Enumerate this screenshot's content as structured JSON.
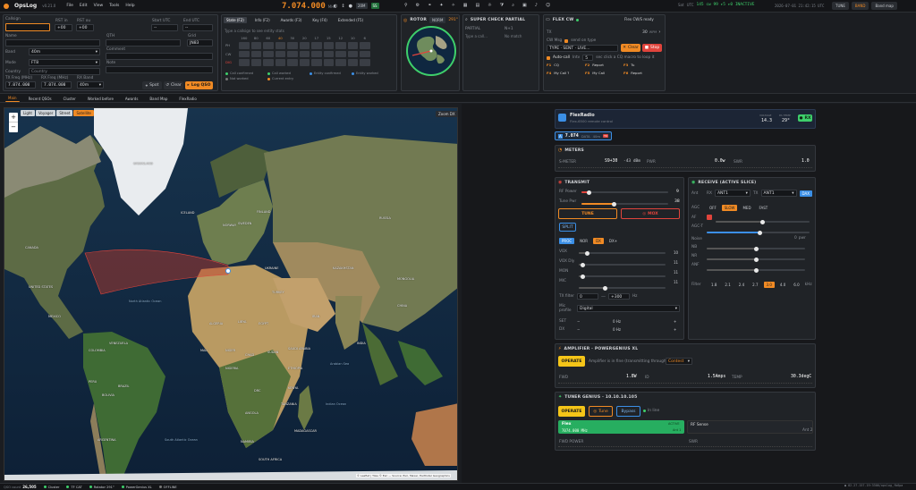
{
  "app": {
    "name": "OpsLog",
    "version": "v0.21.0",
    "menu": [
      "File",
      "Edit",
      "View",
      "Tools",
      "Help"
    ]
  },
  "topbar": {
    "frequency": "7.074.000",
    "freq_unit": "MHz",
    "mode_badge": "20M",
    "band_badge": "SS",
    "clock_label": "Sat",
    "clock_time": "2026-07-01 21:42:15 UTC",
    "utc_label": "UTC",
    "status": "145  cw 99  ▸5  ▸0  INACTIVE",
    "btn_tune": "TUNE",
    "btn_band": "BAND",
    "btn_bandmap": "Band map"
  },
  "entry": {
    "callsign_label": "Callsign",
    "rst_in_label": "RST in",
    "rst_in": "+00",
    "rst_out_label": "RST ou",
    "rst_out": "+00",
    "start_label": "Start UTC",
    "start_val": "--",
    "end_label": "End UTC",
    "end_val": "--",
    "name_label": "Name",
    "qth_label": "QTH",
    "grid_label": "Grid",
    "grid_val": "JN83",
    "band_label": "Band",
    "band_val": "40m",
    "comment_label": "Comment",
    "mode_label": "Mode",
    "mode_val": "FT8",
    "note_label": "Note",
    "country_label": "Country",
    "country_ph": "Country",
    "txfreq_label": "TX Freq (MHz)",
    "txfreq": "7.074.000",
    "rxfreq_label": "RX Freq (MHz)",
    "rxfreq": "7.074.000",
    "rxband_label": "RX Band",
    "rxband": "40m",
    "spot_btn": "Spot",
    "clear_btn": "Clear",
    "log_btn": "Log QSO"
  },
  "band_tabs": [
    "State (F2)",
    "Info (F2)",
    "Awards (F3)",
    "Key (F4)",
    "Extended (F5)"
  ],
  "band_grid": {
    "hint": "Type a callsign to see entity stats",
    "bands": [
      "160",
      "80",
      "60",
      "40",
      "30",
      "20",
      "17",
      "15",
      "12",
      "10",
      "6"
    ],
    "rows": [
      "PH",
      "CW",
      "DIG"
    ],
    "legend": [
      "Call confirmed",
      "Call worked",
      "Entity confirmed",
      "Entity worked",
      "Not worked",
      "Current entry"
    ]
  },
  "rotor": {
    "title": "ROTOR",
    "mode": "NORM",
    "az": "291°"
  },
  "scp": {
    "title": "SUPER CHECK PARTIAL",
    "col1": "PARTIAL",
    "col2": "N+1",
    "ph1": "Type a call...",
    "ph2": "No match"
  },
  "flex_cw": {
    "title": "FLEX CW",
    "status": "Flex CW/S ready",
    "tx_label": "TX",
    "wpm": "30",
    "wpm_unit": "WPM",
    "cw_label": "CW Msg",
    "cw_opt": "send on type",
    "type_ph": "TYPE · SENT · LIVE...",
    "clear_btn": "Clear",
    "stop_btn": "Stop",
    "autocall_label": "Auto-call",
    "interval_label": "Intv",
    "interval": "5",
    "interval_hint": "sec   click a CQ macro to loop it",
    "macros": [
      [
        "F1",
        "CQ"
      ],
      [
        "F2",
        "Report"
      ],
      [
        "F3",
        "Tu"
      ],
      [
        "F4",
        "My Call ?"
      ],
      [
        "F5",
        "My Call"
      ],
      [
        "F6",
        "Report"
      ]
    ]
  },
  "tabs": [
    "Main",
    "Recent QSOs",
    "Cluster",
    "Worked before",
    "Awards",
    "Band Map",
    "FlexRadio"
  ],
  "map": {
    "layers": [
      "Light",
      "Voyager",
      "Street",
      "Satellite"
    ],
    "active_layer": "Satellite",
    "zoom_btn": "Zoom DX",
    "attribution": "© Leaflet | Tiles © Esri — Source: Esri, Maxar, Earthstar Geographics",
    "labels": [
      "GREENLAND",
      "ICELAND",
      "CANADA",
      "UNITED STATES",
      "MEXICO",
      "BRAZIL",
      "PERU",
      "BOLIVIA",
      "ARGENTINA",
      "COLOMBIA",
      "VENEZUELA",
      "RUSSIA",
      "KAZAKHSTAN",
      "MONGOLIA",
      "CHINA",
      "INDIA",
      "IRAN",
      "SAUDI ARABIA",
      "EGYPT",
      "LIBYA",
      "ALGERIA",
      "MALI",
      "NIGER",
      "CHAD",
      "SUDAN",
      "NIGERIA",
      "ETHIOPIA",
      "DRC",
      "ANGOLA",
      "NAMIBIA",
      "SOUTH AFRICA",
      "MADAGASCAR",
      "KENYA",
      "TANZANIA",
      "TURKEY",
      "UKRAINE",
      "SWEDEN",
      "FINLAND",
      "NORWAY",
      "North Atlantic Ocean",
      "Indian Ocean",
      "South Atlantic Ocean",
      "Arabian Sea"
    ]
  },
  "flex": {
    "title": "FlexRadio",
    "subtitle": "Flex-6500 remote control",
    "voltage_label": "VOLTAGE",
    "voltage": "14.3",
    "temp_label": "PA TEMP",
    "temp": "29°",
    "rx_badge": "RX",
    "freq_chip": "7.074",
    "mode_chip": "DATA",
    "slice": "40m",
    "meters": {
      "title": "METERS",
      "smeter_label": "S-METER",
      "smeter": "S9+30",
      "dbm": "-43 dBm",
      "pwr_label": "PWR",
      "pwr": "0.0w",
      "swr_label": "SWR",
      "swr": "1.0"
    },
    "transmit": {
      "title": "TRANSMIT",
      "rfpower_label": "RF Power",
      "rfpower": 9,
      "tunepwr_label": "Tune Pwr",
      "tunepwr": 38,
      "tune_btn": "TUNE",
      "mox_btn": "MOX",
      "split_btn": "SPLIT",
      "proc_btn": "PROC",
      "proc_opts": [
        "NOR",
        "DX",
        "DX+"
      ],
      "sliders": [
        [
          "VOX",
          10
        ],
        [
          "VOX Dly",
          11
        ],
        [
          "MON",
          11
        ],
        [
          "MIC",
          11
        ]
      ],
      "txfilter_label": "TX filter",
      "txfilter_lo": "0",
      "txfilter_hi": "+300",
      "txfilter_unit": "Hz",
      "mic_label": "Mic profile",
      "mic_val": "Digital",
      "sat_rows": [
        [
          "SET",
          "0 Hz"
        ],
        [
          "DX",
          "0 Hz"
        ]
      ]
    },
    "receive": {
      "title": "RECEIVE (ACTIVE SLICE)",
      "ant_label": "Ant",
      "rx_label": "RX",
      "rx_ant": "ANT1",
      "tx_label": "TX",
      "tx_ant": "ANT1",
      "dax": "DAX",
      "agc_label": "AGC",
      "agc_opts": [
        "OFF",
        "SLOW",
        "MED",
        "FAST"
      ],
      "agc_active": "SLOW",
      "af_label": "AF",
      "agct_label": "AGC-T",
      "noise_label": "Noise",
      "noise_val": "0",
      "noise_unit": "pwr",
      "nb_label": "NB",
      "nr_label": "NR",
      "anf_label": "ANF",
      "filter_label": "Filter",
      "filters": [
        "1.8",
        "2.1",
        "2.4",
        "2.7",
        "3.0",
        "4.0",
        "6.0"
      ],
      "filter_active": "3.0",
      "filter_unit": "kHz",
      "levels": {
        "af": 50,
        "agct": 52,
        "nb": 50,
        "nr": 50,
        "anf": 50
      }
    },
    "amp": {
      "title": "AMPLIFIER · POWERGENIUS XL",
      "operate_btn": "OPERATE",
      "msg": "Amplifier is in fine (transmitting through PA) · Fan",
      "fan_val": "Contest",
      "fwd_label": "FWD",
      "fwd": "1.8W",
      "id_label": "ID",
      "id": "1.5Amps",
      "temp_label": "TEMP",
      "temp": "30.3degC"
    },
    "tuner": {
      "title": "TUNER GENIUS · 10.10.10.105",
      "operate_btn": "OPERATE",
      "tune_btn": "Tune",
      "bypass_btn": "Bypass",
      "inline": "In line",
      "flex_label": "Flex",
      "flex_freq": "7074.000 MHz",
      "flex_state": "ACTIVE",
      "flex_ant": "Ant 1",
      "rf_label": "RF Sense",
      "rf_ant": "Ant 2",
      "fwd_label": "FWD POWER",
      "swr_label": "SWR"
    }
  },
  "statusbar": {
    "qso_label": "QSO count",
    "qso": "26,505",
    "items": [
      "Cluster",
      "TF CAT",
      "Rotator 291°",
      "PowerGenius XL",
      "OFFLINE"
    ],
    "ip": "● 82.27.157.19:3306/opslog_fb6pa"
  },
  "colors": {
    "accent": "#f08a24",
    "green": "#3ecf6b",
    "red": "#e0443c",
    "blue": "#3b8fe6"
  }
}
